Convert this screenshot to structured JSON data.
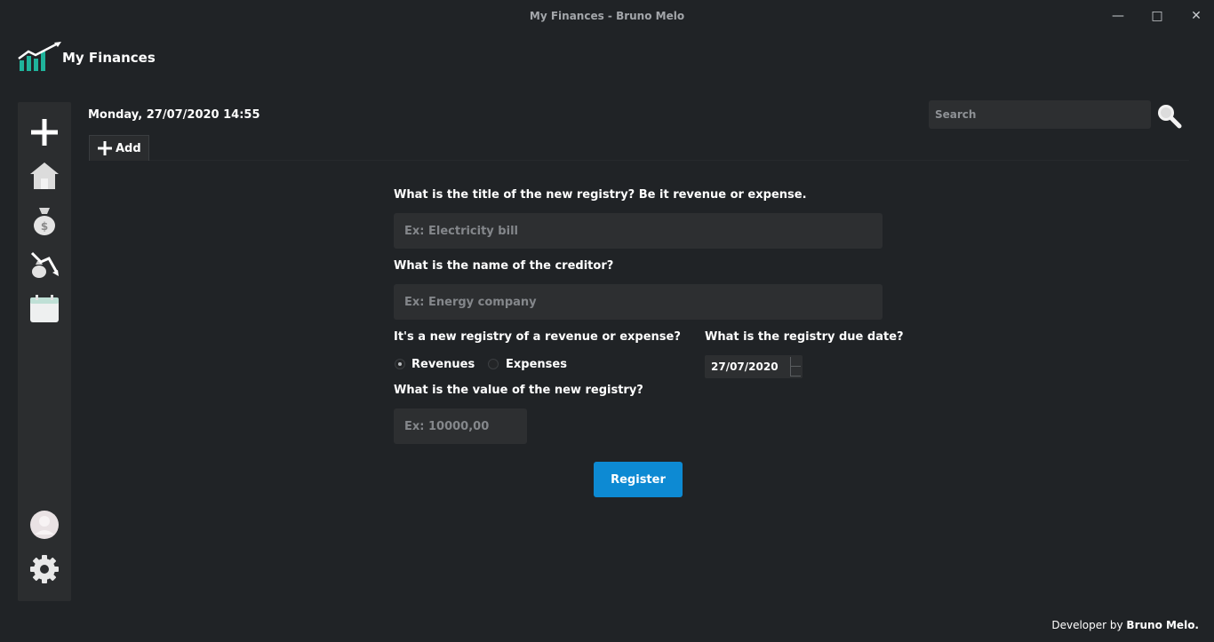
{
  "window": {
    "title": "My Finances - Bruno Melo",
    "minimize_glyph": "—",
    "maximize_glyph": "□",
    "close_glyph": "✕"
  },
  "app": {
    "name": "My Finances",
    "logo_icon": "chart-growth-icon"
  },
  "sidebar": {
    "items": [
      {
        "icon": "plus-icon"
      },
      {
        "icon": "home-icon"
      },
      {
        "icon": "money-bag-icon"
      },
      {
        "icon": "expense-down-icon"
      },
      {
        "icon": "calendar-icon"
      }
    ],
    "bottom_items": [
      {
        "icon": "avatar-icon"
      },
      {
        "icon": "gear-icon"
      }
    ]
  },
  "header": {
    "datetime": "Monday, 27/07/2020  14:55",
    "add_tab_label": "Add",
    "search_placeholder": "Search"
  },
  "form": {
    "title_question": "What is the title of the new registry? Be it revenue or expense.",
    "title_placeholder": "Ex: Electricity bill",
    "creditor_question": "What is the name of the creditor?",
    "creditor_placeholder": "Ex: Energy company",
    "type_question": "It's a new registry of a revenue or expense?",
    "type_options": [
      "Revenues",
      "Expenses"
    ],
    "type_selected": "Revenues",
    "due_date_question": "What is the registry due date?",
    "due_date_value": "27/07/2020",
    "value_question": "What is the value of the new registry?",
    "value_placeholder": "Ex: 10000,00",
    "register_label": "Register"
  },
  "footer": {
    "prefix": "Developer by ",
    "developer": "Bruno Melo."
  },
  "colors": {
    "background": "#202326",
    "sidebar": "#2b2d2f",
    "field": "#2d2f31",
    "accent": "#0d8ad3",
    "logo_teal": "#1fb39b"
  }
}
